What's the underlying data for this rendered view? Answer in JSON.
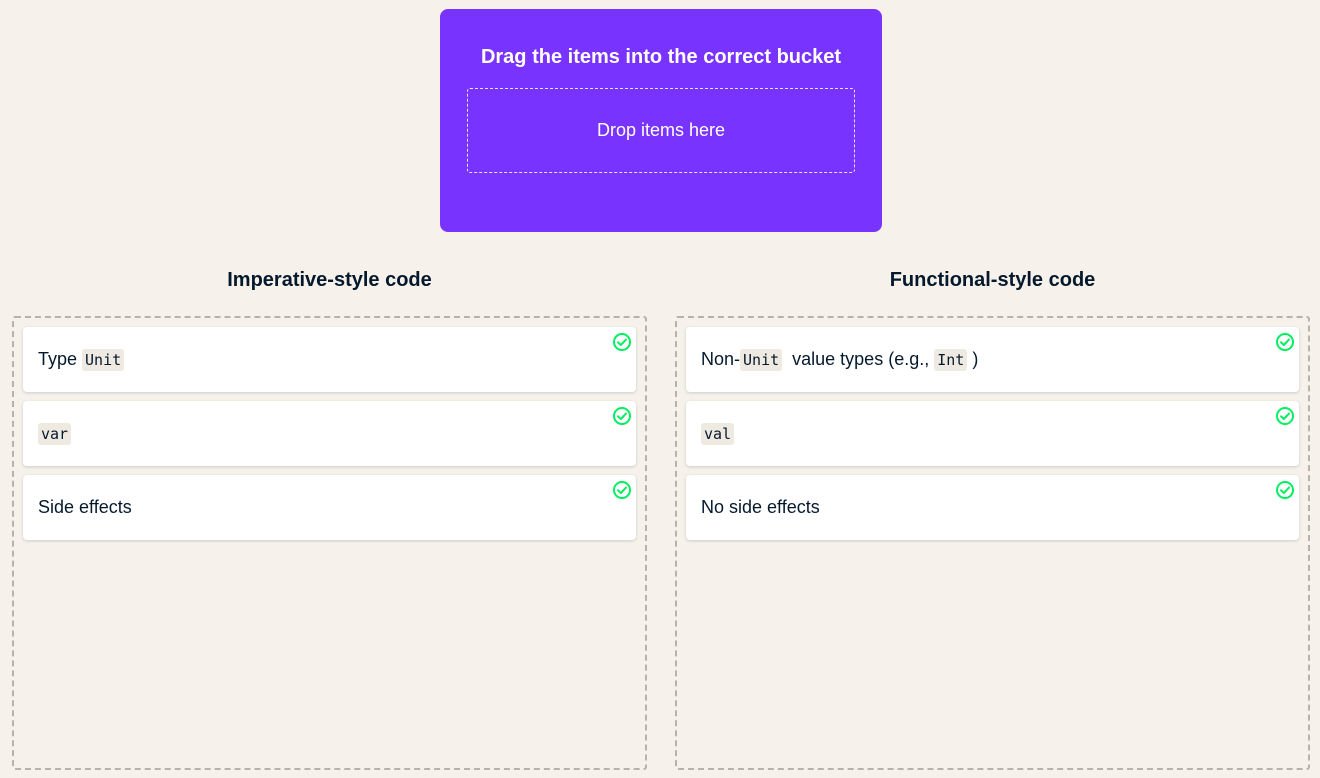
{
  "prompt": {
    "title": "Drag the items into the correct bucket",
    "drop_placeholder": "Drop items here"
  },
  "buckets": [
    {
      "title": "Imperative-style code",
      "items": [
        {
          "pre": "Type ",
          "code1": "Unit",
          "mid": "",
          "code2": "",
          "post": ""
        },
        {
          "pre": "",
          "code1": "var",
          "mid": "",
          "code2": "",
          "post": ""
        },
        {
          "pre": "Side effects",
          "code1": "",
          "mid": "",
          "code2": "",
          "post": ""
        }
      ]
    },
    {
      "title": "Functional-style code",
      "items": [
        {
          "pre": "Non-",
          "code1": "Unit",
          "mid": "  value types (e.g., ",
          "code2": "Int",
          "post": " )"
        },
        {
          "pre": "",
          "code1": "val",
          "mid": "",
          "code2": "",
          "post": ""
        },
        {
          "pre": "No side effects",
          "code1": "",
          "mid": "",
          "code2": "",
          "post": ""
        }
      ]
    }
  ],
  "colors": {
    "background": "#f6f2eb",
    "accent": "#7933ff",
    "correct": "#03ef62",
    "text": "#05192d"
  },
  "icons": {
    "correct": "check-circle-icon"
  }
}
